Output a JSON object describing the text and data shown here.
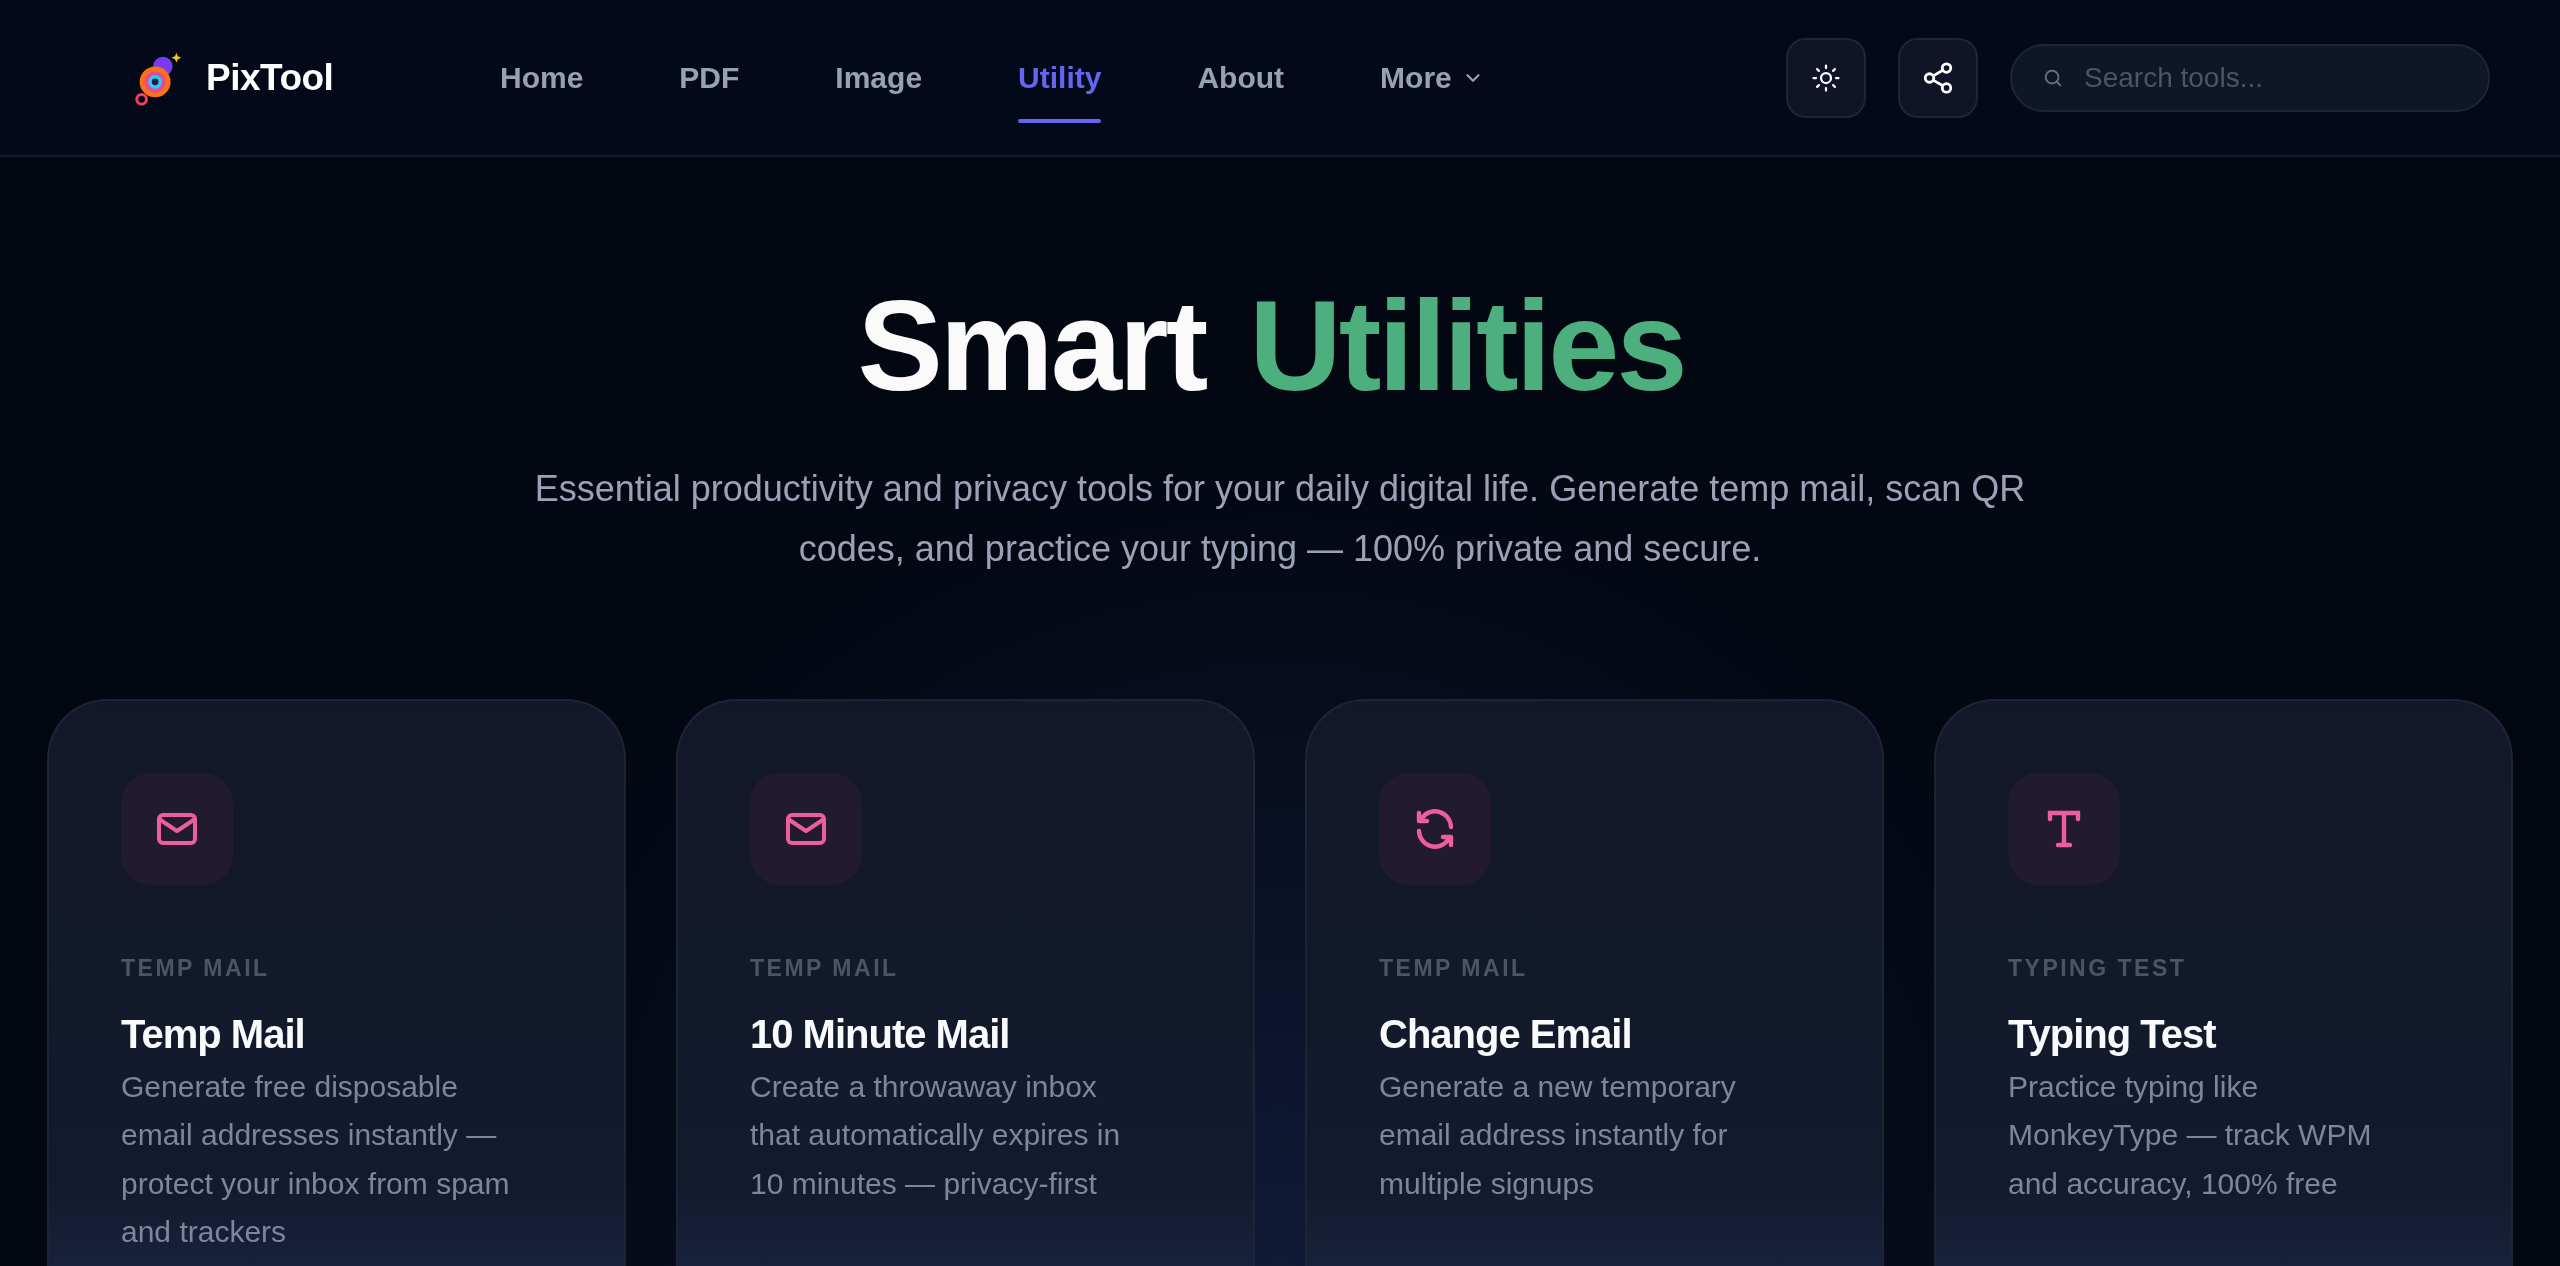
{
  "brand": {
    "name": "PixTool"
  },
  "nav": [
    {
      "label": "Home",
      "selected": false,
      "kind": "link"
    },
    {
      "label": "PDF",
      "selected": false,
      "kind": "link"
    },
    {
      "label": "Image",
      "selected": false,
      "kind": "link"
    },
    {
      "label": "Utility",
      "selected": true,
      "kind": "link"
    },
    {
      "label": "About",
      "selected": false,
      "kind": "link"
    },
    {
      "label": "More",
      "selected": false,
      "kind": "dropdown"
    }
  ],
  "search": {
    "placeholder": "Search tools..."
  },
  "hero": {
    "title_parts": [
      {
        "text": "Smart",
        "kind": "plain"
      },
      {
        "text": "Utilities",
        "kind": "accent"
      }
    ],
    "subtitle": "Essential productivity and privacy tools for your daily digital life. Generate temp mail, scan QR codes, and practice your typing — 100% private and secure."
  },
  "cards": [
    {
      "kind": "mail",
      "category": "TEMP MAIL",
      "title": "Temp Mail",
      "description": "Generate free disposable email addresses instantly — protect your inbox from spam and trackers"
    },
    {
      "kind": "mail",
      "category": "TEMP MAIL",
      "title": "10 Minute Mail",
      "description": "Create a throwaway inbox that automatically expires in 10 minutes — privacy-first"
    },
    {
      "kind": "refresh",
      "category": "TEMP MAIL",
      "title": "Change Email",
      "description": "Generate a new temporary email address instantly for multiple signups"
    },
    {
      "kind": "type",
      "category": "TYPING TEST",
      "title": "Typing Test",
      "description": "Practice typing like MonkeyType — track WPM and accuracy, 100% free"
    }
  ]
}
